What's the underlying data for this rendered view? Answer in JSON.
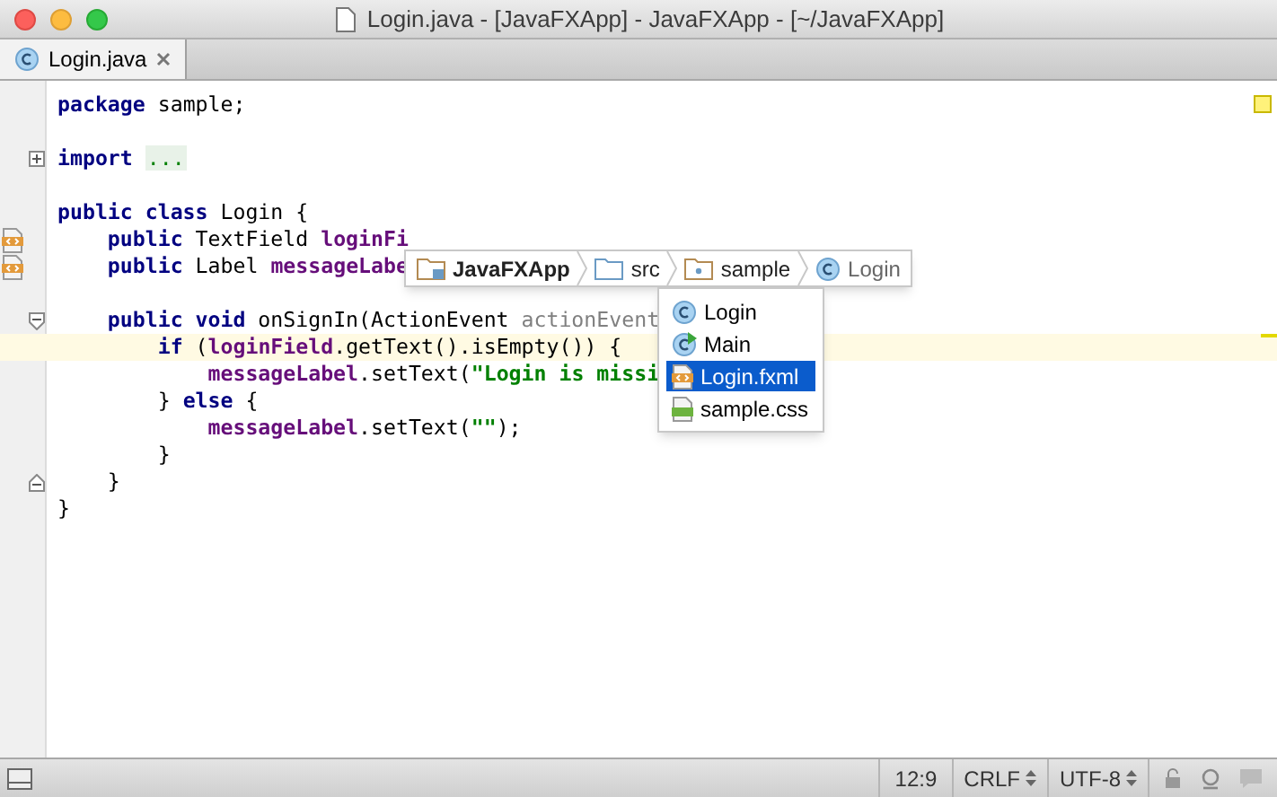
{
  "window": {
    "title": "Login.java - [JavaFXApp] - JavaFXApp - [~/JavaFXApp]"
  },
  "tabs": [
    {
      "label": "Login.java",
      "selected": true,
      "kind": "class"
    }
  ],
  "editor": {
    "lines": [
      {
        "current": false,
        "tokens": [
          {
            "kind": "kw",
            "text": "package"
          },
          {
            "kind": "plain",
            "text": " sample;"
          }
        ]
      },
      {
        "current": false
      },
      {
        "gutter": {
          "kind": "fold-collapsed"
        },
        "current": false,
        "tokens": [
          {
            "kind": "kw",
            "text": "import"
          },
          {
            "kind": "folded",
            "text": "..."
          }
        ]
      },
      {
        "current": false
      },
      {
        "current": false,
        "tokens": [
          {
            "kind": "kw",
            "text": "public class"
          },
          {
            "kind": "plain",
            "text": " Login {"
          }
        ]
      },
      {
        "gutter": {
          "kind": "fxml"
        },
        "current": false,
        "tokens": [
          {
            "kind": "kw",
            "text": "    public"
          },
          {
            "kind": "plain",
            "text": " TextField "
          },
          {
            "kind": "field",
            "text": "loginFi"
          }
        ]
      },
      {
        "gutter": {
          "kind": "fxml"
        },
        "current": false,
        "tokens": [
          {
            "kind": "kw",
            "text": "    public"
          },
          {
            "kind": "plain",
            "text": " Label "
          },
          {
            "kind": "field",
            "text": "messageLabe"
          }
        ]
      },
      {
        "current": false
      },
      {
        "gutter": {
          "kind": "fold-start"
        },
        "current": false,
        "tokens": [
          {
            "kind": "kw",
            "text": "    public void"
          },
          {
            "kind": "plain",
            "text": " onSignIn(ActionEvent "
          },
          {
            "kind": "param",
            "text": "actionEvent"
          }
        ]
      },
      {
        "current": true,
        "tokens": [
          {
            "kind": "kw",
            "text": "        if"
          },
          {
            "kind": "plain",
            "text": " ("
          },
          {
            "kind": "field",
            "text": "loginField"
          },
          {
            "kind": "plain",
            "text": ".getText().isEmpty()) {"
          }
        ]
      },
      {
        "current": false,
        "tokens": [
          {
            "kind": "field",
            "text": "            messageLabel"
          },
          {
            "kind": "plain",
            "text": ".setText("
          },
          {
            "kind": "str",
            "text": "\"Login is missi"
          }
        ]
      },
      {
        "current": false,
        "tokens": [
          {
            "kind": "plain",
            "text": "        } "
          },
          {
            "kind": "kw",
            "text": "else"
          },
          {
            "kind": "plain",
            "text": " {"
          }
        ]
      },
      {
        "current": false,
        "tokens": [
          {
            "kind": "field",
            "text": "            messageLabel"
          },
          {
            "kind": "plain",
            "text": ".setText("
          },
          {
            "kind": "str",
            "text": "\"\""
          },
          {
            "kind": "plain",
            "text": ");"
          }
        ]
      },
      {
        "current": false,
        "tokens": [
          {
            "kind": "plain",
            "text": "        }"
          }
        ]
      },
      {
        "gutter": {
          "kind": "fold-end"
        },
        "current": false,
        "tokens": [
          {
            "kind": "plain",
            "text": "    }"
          }
        ]
      },
      {
        "current": false,
        "tokens": [
          {
            "kind": "plain",
            "text": "}"
          }
        ]
      }
    ]
  },
  "breadcrumb": [
    {
      "label": "JavaFXApp",
      "kind": "module"
    },
    {
      "label": "src",
      "kind": "folder"
    },
    {
      "label": "sample",
      "kind": "package"
    },
    {
      "label": "Login",
      "kind": "class"
    }
  ],
  "popup": [
    {
      "label": "Login",
      "kind": "class",
      "selected": false
    },
    {
      "label": "Main",
      "kind": "main",
      "selected": false
    },
    {
      "label": "Login.fxml",
      "kind": "fxml",
      "selected": true
    },
    {
      "label": "sample.css",
      "kind": "css",
      "selected": false
    }
  ],
  "status_bar": {
    "position": "12:9",
    "line_separator": "CRLF",
    "encoding": "UTF-8"
  }
}
